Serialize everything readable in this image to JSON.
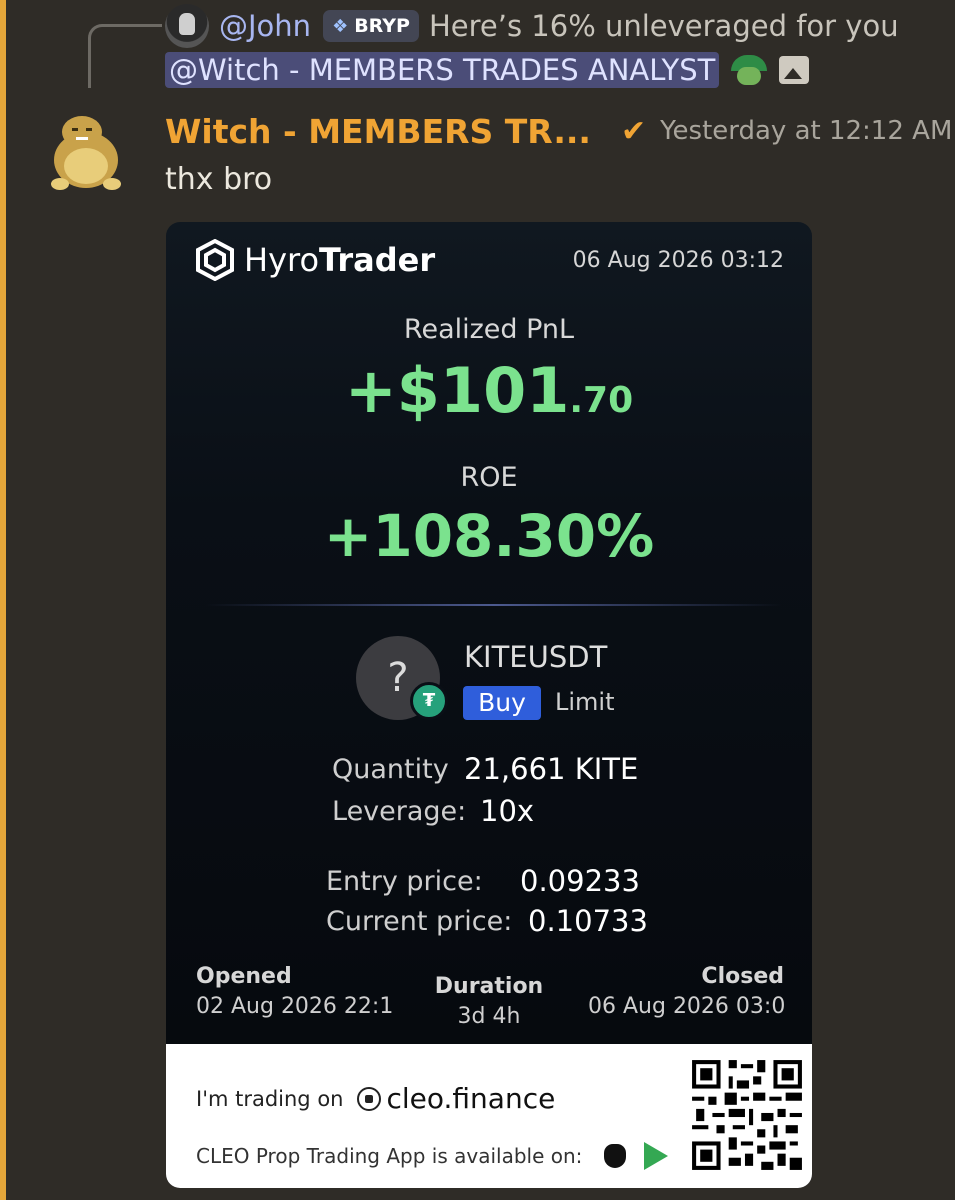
{
  "reply": {
    "user": "@John",
    "tag": "BRYP",
    "text": "Here’s 16% unleveraged for you",
    "mention": "@Witch - MEMBERS TRADES ANALYST"
  },
  "message": {
    "author": "Witch - MEMBERS TR...",
    "check": "✔",
    "timestamp": "Yesterday at 12:12 AM",
    "text": "thx bro"
  },
  "card": {
    "brand_light": "Hyro",
    "brand_bold": "Trader",
    "datetime": "06 Aug 2026 03:12",
    "pnl_label": "Realized PnL",
    "pnl_main": "+$101",
    "pnl_decimal": ".70",
    "roe_label": "ROE",
    "roe_value": "+108.30%",
    "coin_placeholder": "?",
    "coin_badge": "₮",
    "symbol": "KITEUSDT",
    "side": "Buy",
    "order_type": "Limit",
    "quantity_label": "Quantity",
    "quantity_value": "21,661 KITE",
    "leverage_label": "Leverage:",
    "leverage_value": "10x",
    "entry_label": "Entry price:",
    "entry_value": "0.09233",
    "current_label": "Current price:",
    "current_value": "0.10733",
    "opened_label": "Opened",
    "opened_value": "02 Aug 2026 22:1",
    "duration_label": "Duration",
    "duration_value": "3d 4h",
    "closed_label": "Closed",
    "closed_value": "06 Aug 2026 03:0",
    "footer_trading": "I'm trading on",
    "footer_site": "cleo.finance",
    "footer_app": "CLEO Prop Trading App is available on:"
  },
  "colors": {
    "accent_orange": "#f0a434",
    "profit_green": "#7be28e",
    "buy_blue": "#2f5edb",
    "mention_bg": "#4b4d78"
  },
  "icons": [
    "reply-avatar-icon",
    "bryp-diamond-icon",
    "pepe-umbrella-sticker",
    "image-icon",
    "orange-check-icon",
    "hyrotrader-logo-icon",
    "tether-icon",
    "cleo-logo-icon",
    "apple-icon",
    "google-play-icon",
    "qr-code"
  ]
}
